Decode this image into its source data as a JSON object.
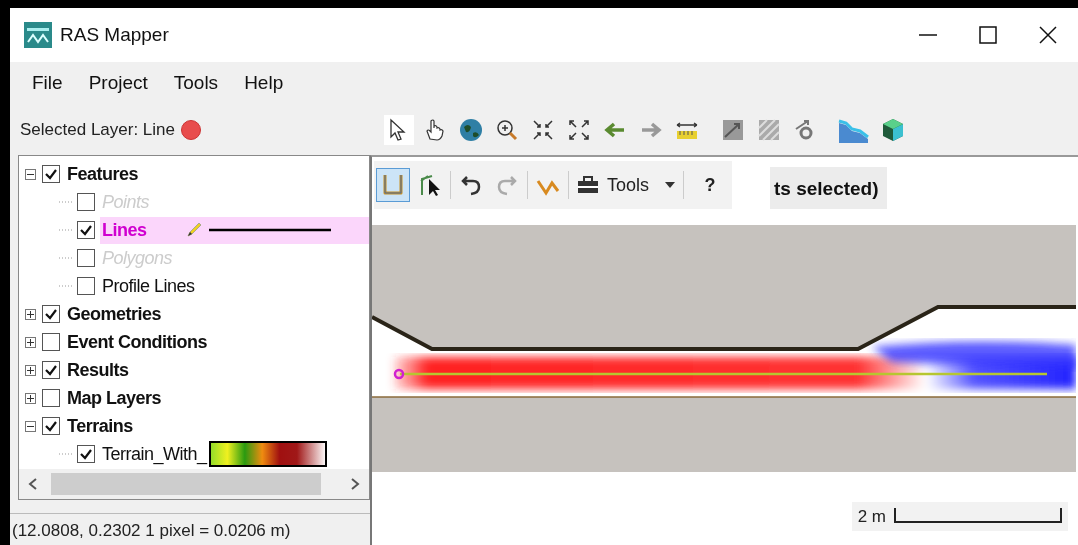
{
  "window": {
    "title": "RAS Mapper"
  },
  "menu": [
    {
      "label": "File"
    },
    {
      "label": "Project"
    },
    {
      "label": "Tools"
    },
    {
      "label": "Help"
    }
  ],
  "selected_layer": {
    "label": "Selected Layer: Line",
    "color": "#e84c4c"
  },
  "tree": [
    {
      "label": "Features",
      "checked": true,
      "expanded": true,
      "children": [
        {
          "label": "Points",
          "checked": false,
          "disabled": true,
          "selected": false
        },
        {
          "label": "Lines",
          "checked": true,
          "disabled": false,
          "selected": true,
          "kind": "line"
        },
        {
          "label": "Polygons",
          "checked": false,
          "disabled": true,
          "selected": false
        },
        {
          "label": "Profile Lines",
          "checked": false,
          "disabled": false,
          "selected": false
        }
      ]
    },
    {
      "label": "Geometries",
      "checked": true,
      "expanded": false
    },
    {
      "label": "Event Conditions",
      "checked": false,
      "expanded": false
    },
    {
      "label": "Results",
      "checked": true,
      "expanded": false
    },
    {
      "label": "Map Layers",
      "checked": false,
      "expanded": false
    },
    {
      "label": "Terrains",
      "checked": true,
      "expanded": true,
      "children": [
        {
          "label": "Terrain_With_",
          "checked": true,
          "disabled": false,
          "selected": false,
          "kind": "ramp"
        }
      ]
    }
  ],
  "status_bar": "(12.0808, 0.2302  1 pixel = 0.0206 m)",
  "edit_toolbar": {
    "tools_label": "Tools",
    "help_label": "?",
    "header_text": "ts selected)"
  },
  "scale_bar": "2 m"
}
